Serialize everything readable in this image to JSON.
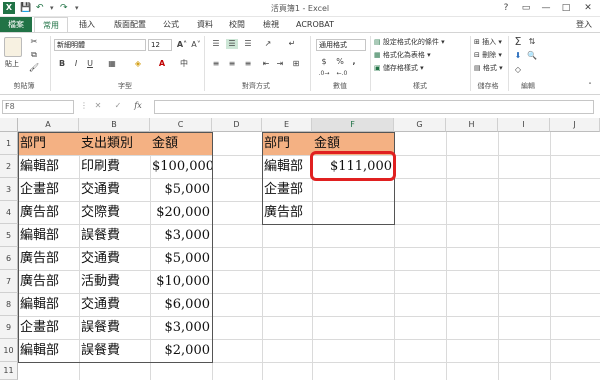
{
  "app": {
    "title": "活頁簿1 - Excel",
    "user": "登入",
    "window_buttons": [
      "?",
      "▭",
      "—",
      "□",
      "✕"
    ]
  },
  "tabs": [
    "檔案",
    "常用",
    "插入",
    "版面配置",
    "公式",
    "資料",
    "校閱",
    "檢視",
    "ACROBAT"
  ],
  "active_tab": "常用",
  "ribbon": {
    "clipboard": {
      "paste": "貼上",
      "label": "剪貼簿"
    },
    "font": {
      "name": "新細明體",
      "size": "12",
      "bold": "B",
      "italic": "I",
      "underline": "U",
      "label": "字型"
    },
    "alignment": {
      "label": "對齊方式"
    },
    "number": {
      "format": "通用格式",
      "currency": "$",
      "percent": "%",
      "comma": ",",
      "label": "數值"
    },
    "styles": {
      "conditional": "設定格式化的條件",
      "table": "格式化為表格",
      "cell": "儲存格樣式",
      "label": "樣式"
    },
    "cells": {
      "insert": "插入",
      "delete": "刪除",
      "format": "格式",
      "label": "儲存格"
    },
    "editing": {
      "label": "編輯"
    }
  },
  "formula_bar": {
    "name_box": "F8",
    "cancel": "✕",
    "enter": "✓",
    "fx": "fx",
    "value": ""
  },
  "sheet": {
    "columns": [
      "A",
      "B",
      "C",
      "D",
      "E",
      "F",
      "G",
      "H",
      "I",
      "J"
    ],
    "rows": [
      "1",
      "2",
      "3",
      "4",
      "5",
      "6",
      "7",
      "8",
      "9",
      "10",
      "11"
    ],
    "table1": {
      "headers": [
        "部門",
        "支出類別",
        "金額"
      ],
      "rows": [
        [
          "編輯部",
          "印刷費",
          "$100,000"
        ],
        [
          "企畫部",
          "交通費",
          "$5,000"
        ],
        [
          "廣告部",
          "交際費",
          "$20,000"
        ],
        [
          "編輯部",
          "誤餐費",
          "$3,000"
        ],
        [
          "廣告部",
          "交通費",
          "$5,000"
        ],
        [
          "廣告部",
          "活動費",
          "$10,000"
        ],
        [
          "編輯部",
          "交通費",
          "$6,000"
        ],
        [
          "企畫部",
          "誤餐費",
          "$3,000"
        ],
        [
          "編輯部",
          "誤餐費",
          "$2,000"
        ]
      ]
    },
    "table2": {
      "headers": [
        "部門",
        "金額"
      ],
      "rows": [
        [
          "編輯部",
          "$111,000"
        ],
        [
          "企畫部",
          ""
        ],
        [
          "廣告部",
          ""
        ]
      ]
    },
    "colors": {
      "header_fill": "#f4b183",
      "highlight": "#e02020",
      "accent": "#217346"
    }
  }
}
